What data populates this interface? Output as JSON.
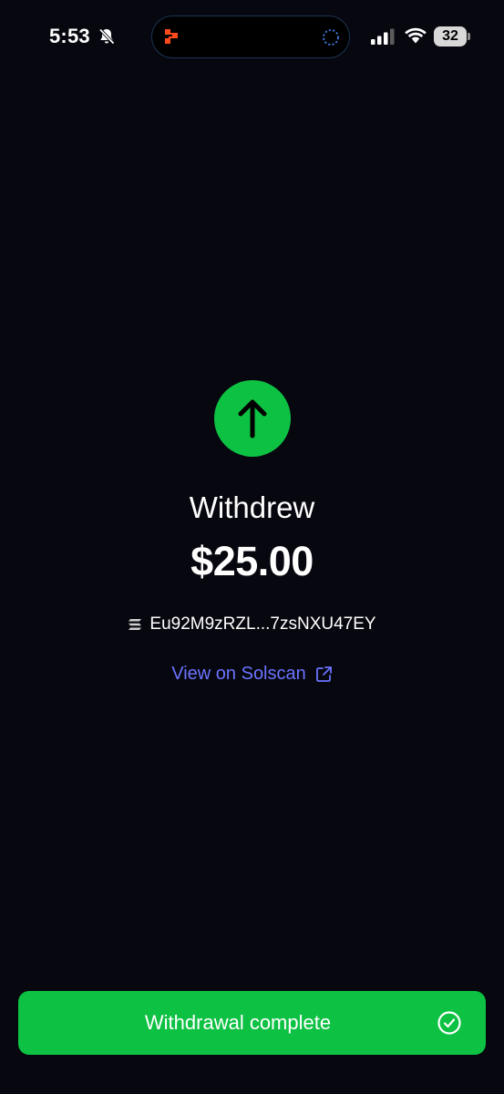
{
  "status_bar": {
    "time": "5:53",
    "battery_level": "32",
    "icons": [
      "bell-muted-icon",
      "signal-icon",
      "wifi-icon",
      "battery-icon"
    ]
  },
  "dynamic_island": {
    "icons": [
      "app-logo-icon",
      "activity-spinner-icon"
    ]
  },
  "transaction": {
    "title": "Withdrew",
    "amount": "$25.00",
    "address": "Eu92M9zRZL...7zsNXU47EY",
    "link_label": "View on Solscan",
    "icon": "arrow-up-icon"
  },
  "footer": {
    "status_label": "Withdrawal complete",
    "icon": "check-circle-icon"
  },
  "colors": {
    "background": "#07070f",
    "accent_green": "#0dc143",
    "link_blue": "#6b74ff"
  }
}
